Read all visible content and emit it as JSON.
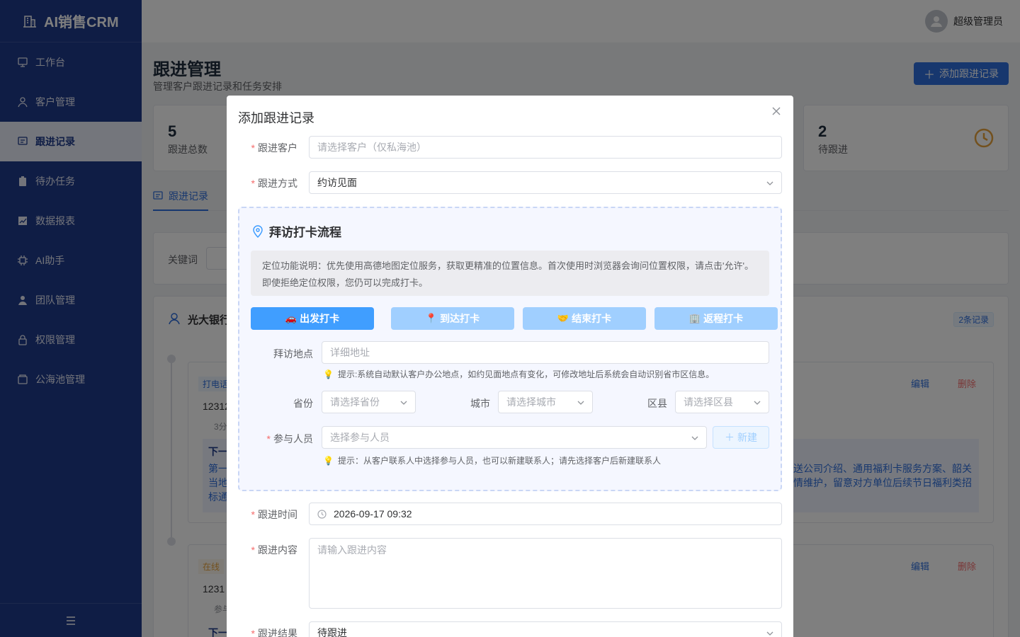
{
  "app": {
    "name": "AI销售CRM"
  },
  "sidebar": {
    "items": [
      {
        "label": "工作台",
        "icon": "dashboard-icon"
      },
      {
        "label": "客户管理",
        "icon": "user-icon"
      },
      {
        "label": "跟进记录",
        "icon": "chat-icon",
        "active": true
      },
      {
        "label": "待办任务",
        "icon": "clipboard-icon"
      },
      {
        "label": "数据报表",
        "icon": "chart-icon"
      },
      {
        "label": "AI助手",
        "icon": "chip-icon"
      },
      {
        "label": "团队管理",
        "icon": "team-icon"
      },
      {
        "label": "权限管理",
        "icon": "lock-icon"
      },
      {
        "label": "公海池管理",
        "icon": "folder-icon"
      }
    ]
  },
  "header": {
    "username": "超级管理员"
  },
  "page": {
    "title": "跟进管理",
    "subtitle": "管理客户跟进记录和任务安排",
    "add_button": "添加跟进记录",
    "stats": [
      {
        "value": "5",
        "label": "跟进总数"
      },
      {
        "value": "2",
        "label": "待跟进"
      }
    ],
    "tab": "跟进记录",
    "filter_label": "关键词",
    "group_name": "光大银行",
    "group_count": "2条记录",
    "card1": {
      "tag": "打电话",
      "title": "12312",
      "time": "3分",
      "next": "下一",
      "line1": "第一",
      "line2": "当地",
      "line3": "标通",
      "desc1": "送公司介绍、通用福利卡服务方案、韶关",
      "desc2": "情维护，留意对方单位后续节日福利类招"
    },
    "card2": {
      "tag": "在线",
      "title": "1231",
      "meta": "参与",
      "next": "下一"
    },
    "edit": "编辑",
    "delete": "删除"
  },
  "dialog": {
    "title": "添加跟进记录",
    "customer_label": "跟进客户",
    "customer_placeholder": "请选择客户（仅私海池）",
    "method_label": "跟进方式",
    "method_value": "约访见面",
    "checkin": {
      "title": "拜访打卡流程",
      "note": "定位功能说明：优先使用高德地图定位服务，获取更精准的位置信息。首次使用时浏览器会询问位置权限，请点击'允许'。即使拒绝定位权限，您仍可以完成打卡。",
      "buttons": [
        {
          "emoji": "🚗",
          "label": "出发打卡"
        },
        {
          "emoji": "📍",
          "label": "到达打卡"
        },
        {
          "emoji": "🤝",
          "label": "结束打卡"
        },
        {
          "emoji": "🏢",
          "label": "返程打卡"
        }
      ],
      "address_label": "拜访地点",
      "address_placeholder": "详细地址",
      "address_tip": "提示:系统自动默认客户办公地点，如约见面地点有变化，可修改地址后系统会自动识别省市区信息。",
      "province_label": "省份",
      "province_placeholder": "请选择省份",
      "city_label": "城市",
      "city_placeholder": "请选择城市",
      "district_label": "区县",
      "district_placeholder": "请选择区县",
      "participants_label": "参与人员",
      "participants_placeholder": "选择参与人员",
      "new_button": "新建",
      "participants_tip": "提示：从客户联系人中选择参与人员，也可以新建联系人；请先选择客户后新建联系人"
    },
    "time_label": "跟进时间",
    "time_value": "2026-09-17 09:32",
    "content_label": "跟进内容",
    "content_placeholder": "请输入跟进内容",
    "result_label": "跟进结果",
    "result_value": "待跟进"
  },
  "colors": {
    "sidebar": "#1e3a8a",
    "primary": "#409eff",
    "danger": "#f56c6c"
  }
}
